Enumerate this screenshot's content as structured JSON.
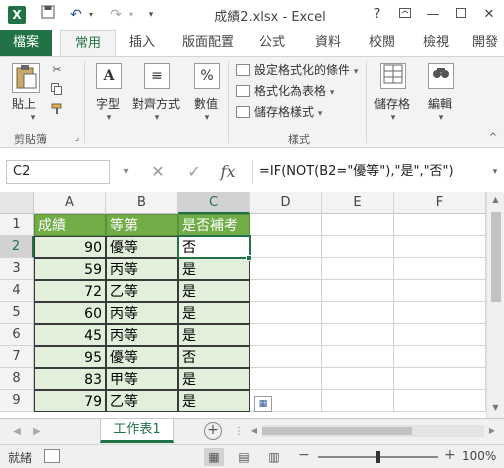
{
  "titlebar": {
    "app_icon": "X",
    "title": "成績2.xlsx - Excel",
    "help": "?",
    "icons": [
      "excel-icon",
      "save-icon",
      "undo-icon",
      "redo-icon",
      "customize-quick-access-icon",
      "help-icon",
      "ribbon-display-icon",
      "minimize-icon",
      "maximize-icon",
      "close-icon"
    ]
  },
  "ribbon_tabs": [
    "檔案",
    "常用",
    "插入",
    "版面配置",
    "公式",
    "資料",
    "校閱",
    "檢視",
    "開發"
  ],
  "ribbon": {
    "paste": "貼上",
    "clipboard_group": "剪貼簿",
    "font": "字型",
    "alignment": "對齊方式",
    "number": "數值",
    "number_symbol": "%",
    "conditional_formatting": "設定格式化的條件",
    "format_as_table": "格式化為表格",
    "cell_styles": "儲存格樣式",
    "styles_group": "樣式",
    "cells": "儲存格",
    "editing": "編輯"
  },
  "formula_bar": {
    "name_box": "C2",
    "cancel": "✕",
    "enter": "✓",
    "fx": "fx",
    "formula": "=IF(NOT(B2=\"優等\"),\"是\",\"否\")"
  },
  "sheet": {
    "columns": [
      "A",
      "B",
      "C",
      "D",
      "E",
      "F"
    ],
    "rows": [
      "1",
      "2",
      "3",
      "4",
      "5",
      "6",
      "7",
      "8",
      "9"
    ],
    "header": [
      "成績",
      "等第",
      "是否補考"
    ],
    "data": [
      [
        "90",
        "優等",
        "否"
      ],
      [
        "59",
        "丙等",
        "是"
      ],
      [
        "72",
        "乙等",
        "是"
      ],
      [
        "60",
        "丙等",
        "是"
      ],
      [
        "45",
        "丙等",
        "是"
      ],
      [
        "95",
        "優等",
        "否"
      ],
      [
        "83",
        "甲等",
        "是"
      ],
      [
        "79",
        "乙等",
        "是"
      ]
    ],
    "active_cell": "C2"
  },
  "sheet_tabs": {
    "active": "工作表1",
    "add": "+"
  },
  "statusbar": {
    "status": "就緒",
    "zoom": "100%",
    "zoom_minus": "−",
    "zoom_plus": "+"
  },
  "colors": {
    "brand": "#217346",
    "header_fill": "#70ad47",
    "data_fill": "#e2efda"
  }
}
